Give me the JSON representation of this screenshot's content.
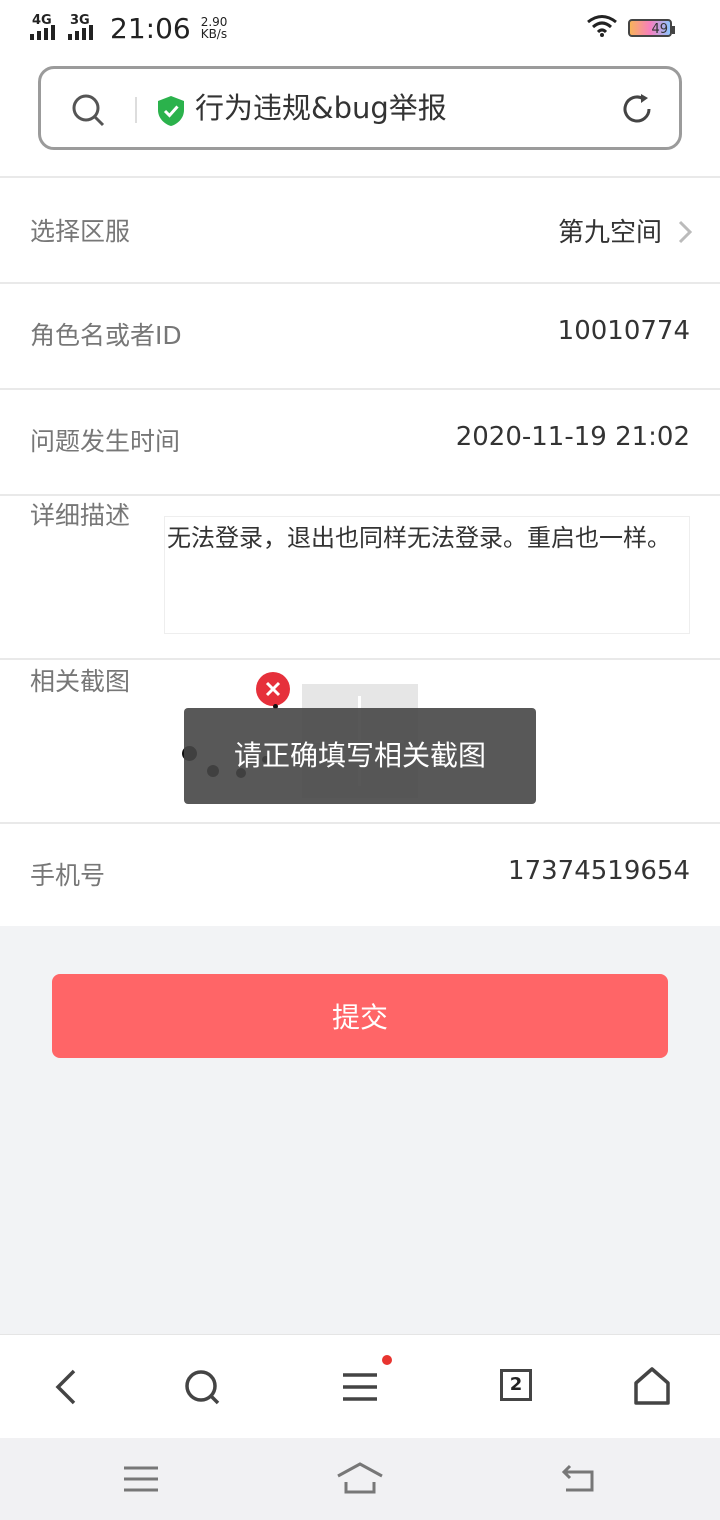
{
  "status_bar": {
    "network_1": "4G",
    "network_2": "3G",
    "time": "21:06",
    "speed_value": "2.90",
    "speed_unit": "KB/s",
    "battery": "49"
  },
  "address_bar": {
    "title": "行为违规&bug举报"
  },
  "form": {
    "region": {
      "label": "选择区服",
      "value": "第九空间"
    },
    "role": {
      "label": "角色名或者ID",
      "value": "10010774"
    },
    "time": {
      "label": "问题发生时间",
      "value": "2020-11-19 21:02"
    },
    "description": {
      "label": "详细描述",
      "value": "无法登录，退出也同样无法登录。重启也一样。"
    },
    "screenshot": {
      "label": "相关截图"
    },
    "phone": {
      "label": "手机号",
      "value": "17374519654"
    }
  },
  "toast": "请正确填写相关截图",
  "submit_label": "提交",
  "browser_toolbar": {
    "tab_count": "2"
  },
  "colors": {
    "submit": "#ff6567",
    "toast_bg": "#464646",
    "shield": "#2bb24c",
    "delete": "#e6303b"
  }
}
